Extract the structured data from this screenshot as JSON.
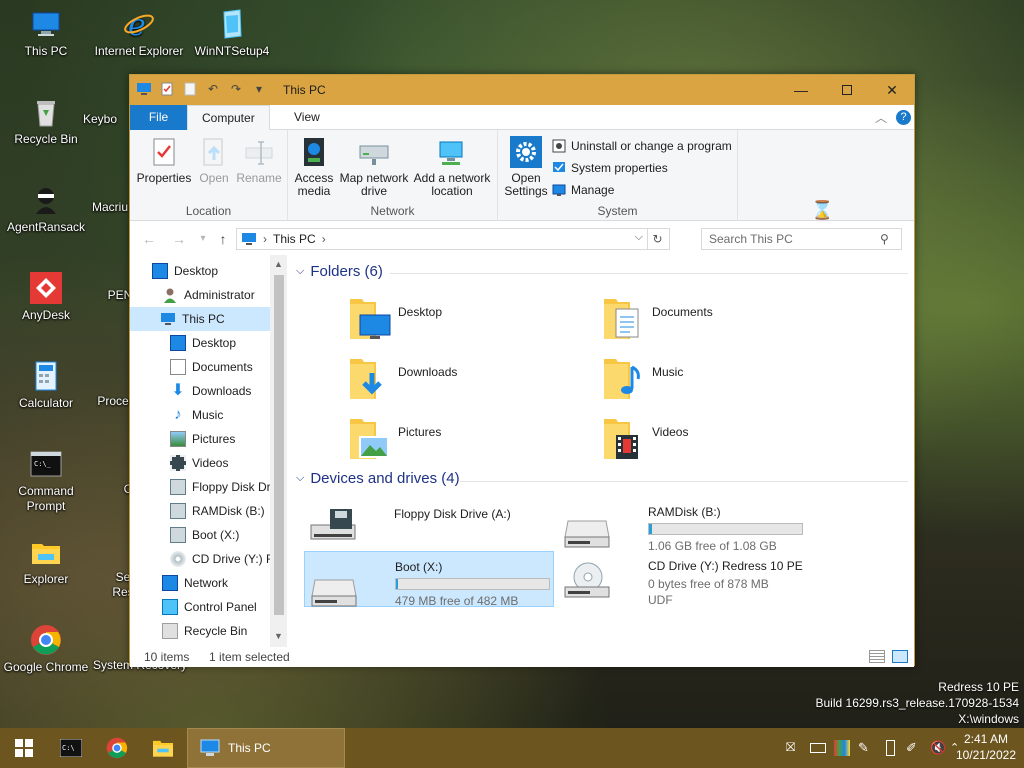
{
  "desktop": {
    "icons": [
      {
        "label": "This PC"
      },
      {
        "label": "Internet Explorer"
      },
      {
        "label": "WinNTSetup4"
      },
      {
        "label": "Recycle Bin"
      },
      {
        "label": "Keybo"
      },
      {
        "label": "AgentRansack"
      },
      {
        "label": "Macriu"
      },
      {
        "label": "AnyDesk"
      },
      {
        "label": "PEN"
      },
      {
        "label": "Calculator"
      },
      {
        "label": "Proces"
      },
      {
        "label": "Command Prompt"
      },
      {
        "label": "C"
      },
      {
        "label": "Explorer"
      },
      {
        "label": "Se Res"
      },
      {
        "label": "Google Chrome"
      },
      {
        "label": "System Recovery"
      }
    ]
  },
  "window": {
    "title": "This PC",
    "tabs": {
      "file": "File",
      "computer": "Computer",
      "view": "View"
    },
    "ribbon": {
      "location": {
        "group": "Location",
        "properties": "Properties",
        "open": "Open",
        "rename": "Rename"
      },
      "network": {
        "group": "Network",
        "access_media": "Access media",
        "map_network_drive": "Map network drive",
        "add_network_location": "Add a network location"
      },
      "system": {
        "group": "System",
        "open_settings": "Open Settings",
        "uninstall": "Uninstall or change a program",
        "system_properties": "System properties",
        "manage": "Manage"
      }
    },
    "address": {
      "crumb": "This PC"
    },
    "search": {
      "placeholder": "Search This PC"
    },
    "nav": [
      "Desktop",
      "Administrator",
      "This PC",
      "Desktop",
      "Documents",
      "Downloads",
      "Music",
      "Pictures",
      "Videos",
      "Floppy Disk Dri",
      "RAMDisk (B:)",
      "Boot (X:)",
      "CD Drive (Y:) R",
      "Network",
      "Control Panel",
      "Recycle Bin"
    ],
    "folders_header": "Folders (6)",
    "folders": [
      "Desktop",
      "Documents",
      "Downloads",
      "Music",
      "Pictures",
      "Videos"
    ],
    "drives_header": "Devices and drives (4)",
    "drives": {
      "floppy": {
        "name": "Floppy Disk Drive (A:)"
      },
      "ramdisk": {
        "name": "RAMDisk (B:)",
        "free": "1.06 GB free of 1.08 GB",
        "used_fraction": 0.02
      },
      "boot": {
        "name": "Boot (X:)",
        "free": "479 MB free of 482 MB",
        "used_fraction": 0.01
      },
      "cd": {
        "name": "CD Drive (Y:) Redress 10 PE",
        "free": "0 bytes free of 878 MB",
        "fs": "UDF"
      }
    },
    "status": {
      "items": "10 items",
      "selected": "1 item selected"
    }
  },
  "watermark": {
    "line1": "Redress 10 PE",
    "line2": "Build 16299.rs3_release.170928-1534",
    "line3": "X:\\windows"
  },
  "taskbar": {
    "active_window": "This PC",
    "time": "2:41 AM",
    "date": "10/21/2022"
  },
  "colors": {
    "accent": "#1979ca",
    "titlebar": "#d9a441",
    "taskbar": "#6d5520",
    "selection": "#cce8ff"
  }
}
